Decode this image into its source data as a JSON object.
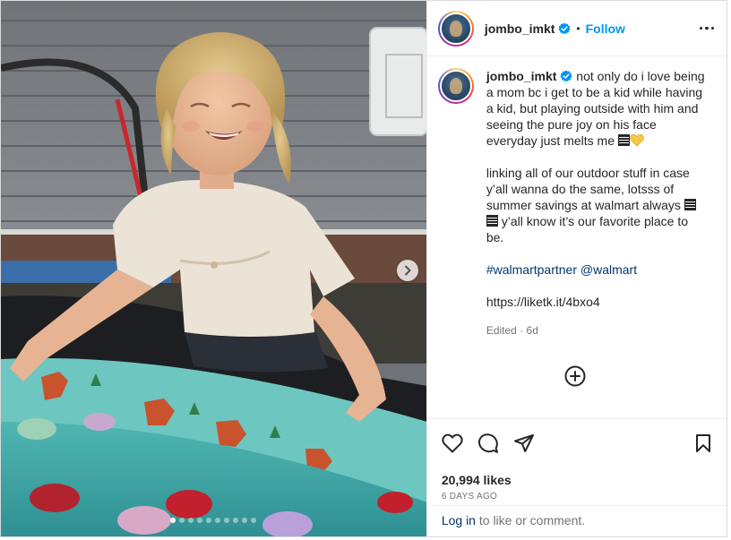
{
  "post": {
    "username": "jombo_imkt",
    "follow_label": "Follow",
    "separator": "•",
    "caption": {
      "username": "jombo_imkt",
      "paragraph1": "not only do i love being a mom bc i get to be a kid while having a kid, but playing outside with him and seeing the pure joy on his face everyday just melts me",
      "paragraph2_part1": "linking all of our outdoor stuff in case y’all wanna do the same, lotsss of summer savings at walmart always",
      "paragraph2_part2": "y’all know it’s our favorite place to be.",
      "hashtag": "#walmartpartner",
      "mention": "@walmart",
      "url": "https://liketk.it/4bxo4",
      "edited": "Edited",
      "meta_sep": "·",
      "age": "6d"
    },
    "likes": "20,994 likes",
    "time": "6 DAYS AGO",
    "login_link": "Log in",
    "login_rest": " to like or comment.",
    "carousel": {
      "total": 10,
      "active_index": 0
    },
    "icons": [
      "next-chevron-icon",
      "verified-badge-icon",
      "more-options-icon",
      "load-more-comments-icon",
      "heart-icon",
      "comment-icon",
      "share-icon",
      "bookmark-icon"
    ],
    "colors": {
      "accent": "#0095f6",
      "link": "#00376b",
      "text": "#262626",
      "muted": "#737373"
    }
  }
}
